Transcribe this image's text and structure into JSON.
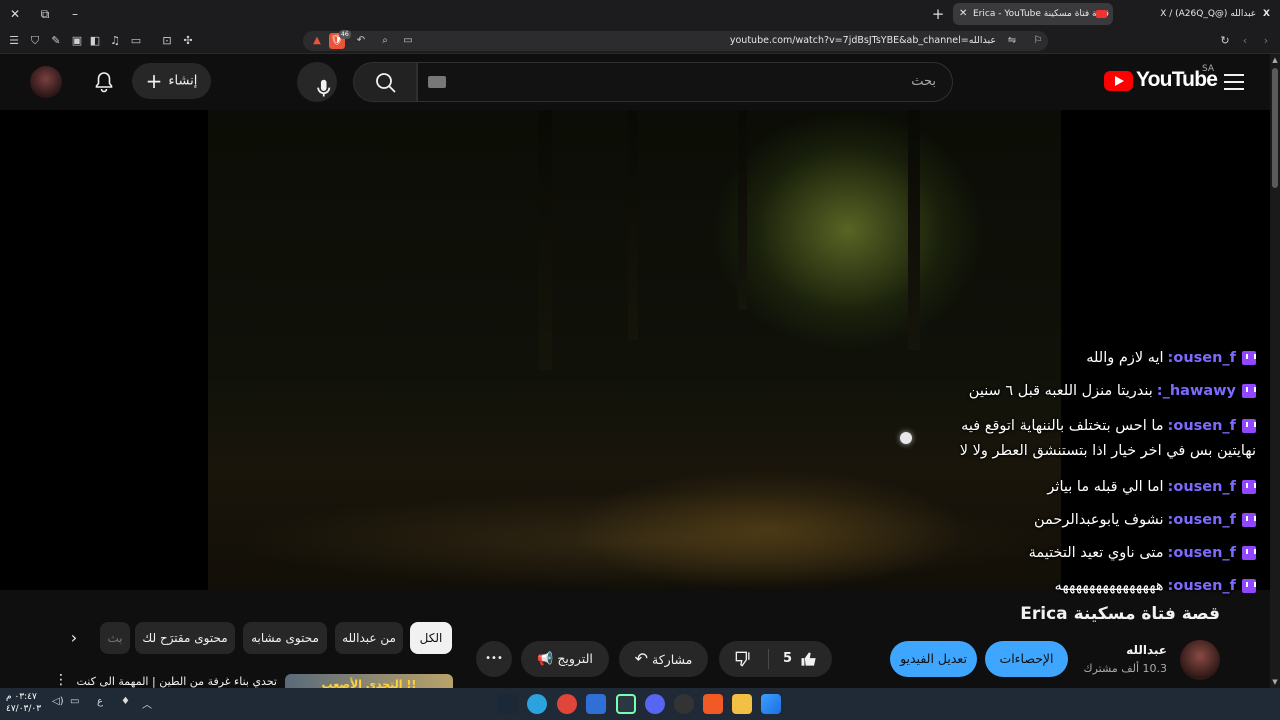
{
  "browser": {
    "active_tab_title": "Erica - YouTube قصة فتاة مسكينة",
    "other_tab_title": "X / (A26Q_Q@) عبدالله",
    "url": "youtube.com/watch?v=7jdBsJTsYBE&ab_channel=عبدالله",
    "shields_count": "46",
    "window_controls": [
      "✕",
      "⧉",
      "–"
    ]
  },
  "header": {
    "create_label": "إنشاء",
    "search_placeholder": "بحث",
    "logo_text": "YouTube",
    "country_code": "SA"
  },
  "chat": [
    {
      "user": "ousen_f:",
      "text": "ايه لازم والله"
    },
    {
      "user": "hawawy_:",
      "text": "بندريتا منزل اللعبه قبل ٦ سنين"
    },
    {
      "user": "ousen_f:",
      "text": "ما احس بتختلف بالننهاية اتوقع فيه نهايتين بس في اخر خيار اذا بتستنشق العطر ولا لا"
    },
    {
      "user": "ousen_f:",
      "text": "اما الي قبله ما بياثر"
    },
    {
      "user": "ousen_f:",
      "text": "نشوف يابوعبدالرحمن"
    },
    {
      "user": "ousen_f:",
      "text": "متى ناوي تعيد التختيمة"
    },
    {
      "user": "ousen_f:",
      "text": "هههههههههههههههه"
    }
  ],
  "video": {
    "title": "قصة فتاة مسكينة Erica",
    "channel_name": "عبدالله",
    "subscribers": "10.3 ألف مشترك",
    "analytics_label": "الإحصاءات",
    "edit_label": "تعديل الفيديو",
    "like_count": "5",
    "share_label": "مشاركة",
    "promote_label": "الترويج",
    "more_label": "•••"
  },
  "chips": [
    {
      "label": "الكل",
      "active": true
    },
    {
      "label": "من عبدالله",
      "active": false
    },
    {
      "label": "محتوى مشابه",
      "active": false
    },
    {
      "label": "محتوى مقترَح لك",
      "active": false
    },
    {
      "label": "بث",
      "active": false
    }
  ],
  "recommendation": {
    "title": "تحدي بناء غرفة من الطين | المهمة الى كنت",
    "thumb_text": "التحدي الأصعب !!"
  },
  "taskbar": {
    "time": "٠٣:٤٧ م",
    "date": "٤٧/٠٣/٠٣",
    "lang": "ع"
  }
}
